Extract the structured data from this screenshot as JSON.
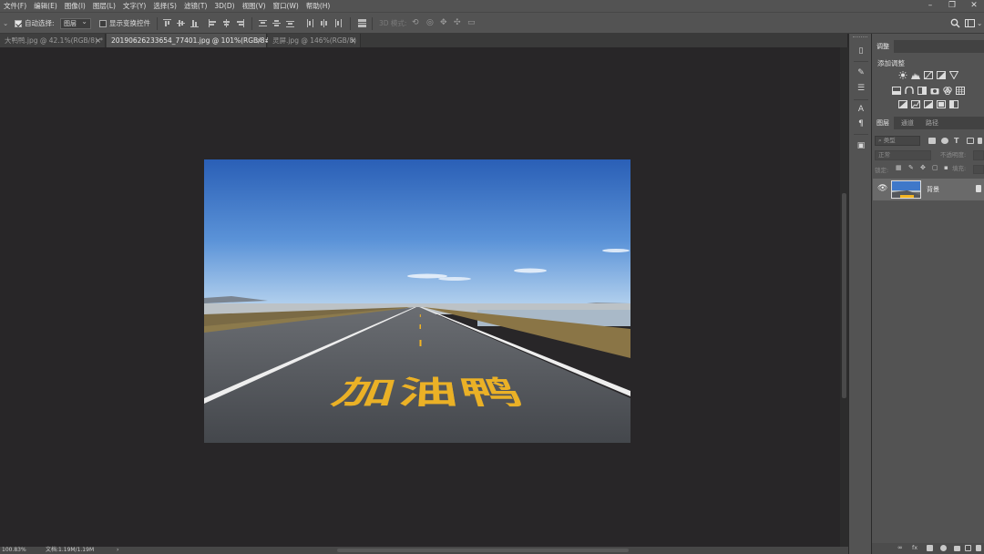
{
  "menu": [
    "文件(F)",
    "编辑(E)",
    "图像(I)",
    "图层(L)",
    "文字(Y)",
    "选择(S)",
    "滤镜(T)",
    "3D(D)",
    "视图(V)",
    "窗口(W)",
    "帮助(H)"
  ],
  "window_controls": [
    "–",
    "❐",
    "✕"
  ],
  "options": {
    "auto_select_label": "自动选择:",
    "auto_select_value": "图层",
    "show_transform_label": "显示变换控件",
    "mode_3d_label": "3D 模式:"
  },
  "tabs": [
    {
      "label": "大鸭鸭.jpg @ 42.1%(RGB/8) *",
      "active": false
    },
    {
      "label": "20190626233654_77401.jpg @ 101%(RGB/8#) *",
      "active": true
    },
    {
      "label": "灵屏.jpg @ 146%(RGB/8)",
      "active": false
    }
  ],
  "canvas_text": "加油鸭",
  "status": {
    "zoom": "100.83%",
    "doc": "文档:1.19M/1.19M"
  },
  "panels": {
    "adjust_tab": "调整",
    "adjust_title": "添加调整",
    "layer_tabs": [
      "图层",
      "通道",
      "路径"
    ],
    "search_placeholder": "类型",
    "blend_mode": "正常",
    "opacity_label": "不透明度:",
    "lock_label": "锁定:",
    "fill_label": "填充:",
    "layer_name": "背景"
  },
  "colors": {
    "accent_text": "#f3b522",
    "sky_top": "#2c64b8",
    "road": "#4f5257"
  }
}
